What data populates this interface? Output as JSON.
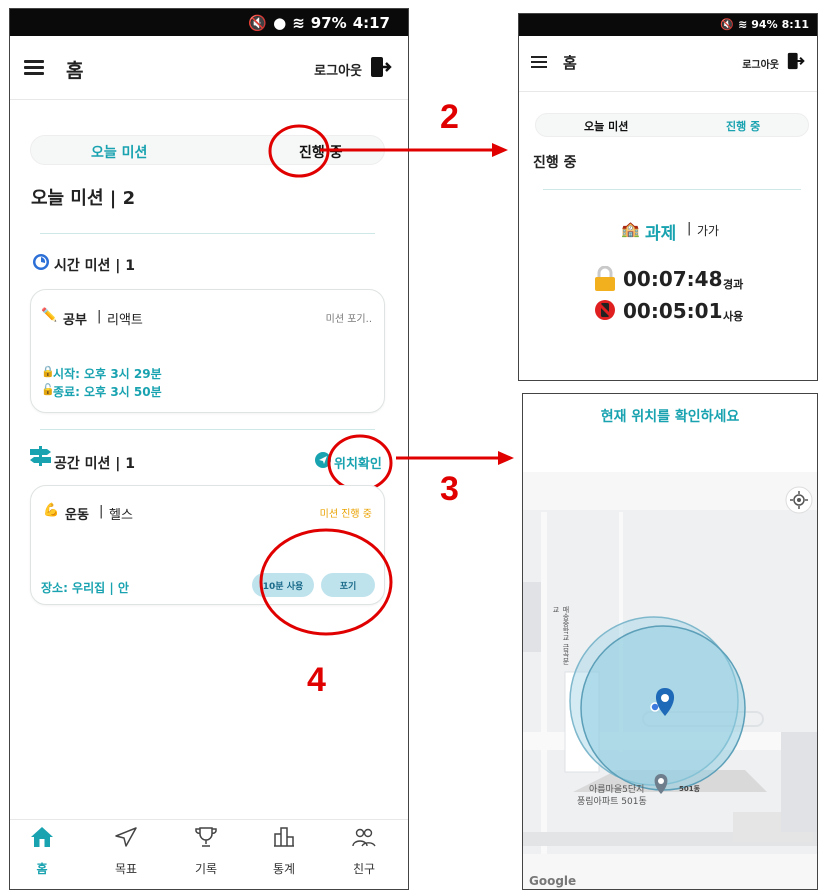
{
  "left": {
    "status": {
      "battery": "97%",
      "time": "4:17"
    },
    "appbar": {
      "title": "홈",
      "logout": "로그아웃"
    },
    "tabs": {
      "today": "오늘 미션",
      "progress": "진행 중"
    },
    "mission_header": "오늘 미션 | 2",
    "time_section": {
      "title": "시간 미션 | 1"
    },
    "time_card": {
      "emoji": "✏️",
      "category": "공부",
      "sep": "|",
      "name": "리액트",
      "action": "미션 포기..",
      "start": "시작: 오후 3시 29분",
      "end": "종료: 오후 3시 50분"
    },
    "space_section": {
      "title": "공간 미션 | 1",
      "check": "위치확인"
    },
    "space_card": {
      "emoji": "💪",
      "category": "운동",
      "sep": "|",
      "name": "헬스",
      "status": "미션 진행 중",
      "place": "장소: 우리집 | 안",
      "use_btn": "10분 사용",
      "quit_btn": "포기"
    },
    "nav": [
      {
        "label": "홈",
        "icon": "home-icon"
      },
      {
        "label": "목표",
        "icon": "send-icon"
      },
      {
        "label": "기록",
        "icon": "trophy-icon"
      },
      {
        "label": "통계",
        "icon": "building-icon"
      },
      {
        "label": "친구",
        "icon": "friends-icon"
      }
    ],
    "accent": "#19a3b0"
  },
  "annotations": {
    "n2": "2",
    "n3": "3",
    "n4": "4",
    "color": "#e00000"
  },
  "right_top": {
    "status": {
      "battery": "94%",
      "time": "8:11"
    },
    "appbar": {
      "title": "홈",
      "logout": "로그아웃"
    },
    "tabs": {
      "today": "오늘 미션",
      "progress": "진행 중"
    },
    "heading": "진행 중",
    "mission": {
      "emoji": "🏫",
      "name": "과제",
      "sep": "|",
      "detail": "가가"
    },
    "elapsed": {
      "value": "00:07:48",
      "suffix": "경과"
    },
    "used": {
      "value": "00:05:01",
      "suffix": "사용"
    }
  },
  "right_bottom": {
    "title": "현재 위치를 확인하세요",
    "labels": {
      "school": "매송중학교 금곡분교",
      "apt": "아름마을5단지",
      "apt2": "풍림아파트 501동",
      "bldg": "501동"
    },
    "google": "Google"
  }
}
